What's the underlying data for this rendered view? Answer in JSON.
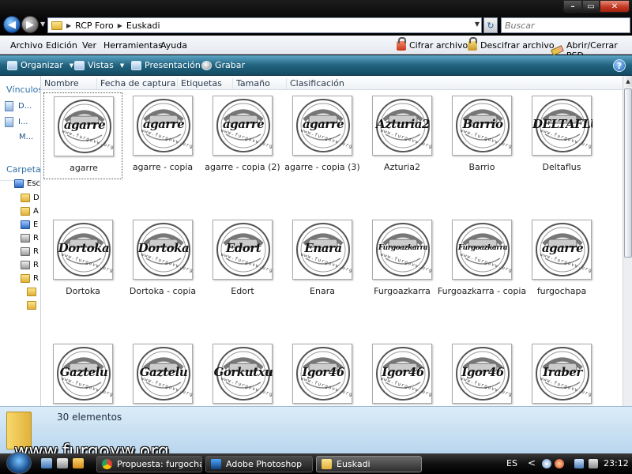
{
  "window": {
    "address_path": [
      "RCP Foro",
      "Euskadi"
    ],
    "search_placeholder": "Buscar"
  },
  "menubar": {
    "items": [
      "Archivo",
      "Edición",
      "Ver",
      "Herramientas",
      "Ayuda"
    ],
    "encrypt": "Cifrar archivo",
    "decrypt": "Descifrar archivo",
    "psd": "Abrir/Cerrar PSD"
  },
  "commandbar": {
    "organize": "Organizar",
    "views": "Vistas",
    "presentation": "Presentación",
    "burn": "Grabar"
  },
  "navpane": {
    "links_title": "Vínculos",
    "links": [
      "D...",
      "I...",
      "M..."
    ],
    "folders_title": "Carpetas",
    "tree": [
      "Esc",
      "D",
      "A",
      "E",
      "R",
      "R",
      "R",
      "R"
    ]
  },
  "columns": [
    "Nombre",
    "Fecha de captura",
    "Etiquetas",
    "Tamaño",
    "Clasificación"
  ],
  "files": [
    {
      "name": "agarre",
      "thumb_text": "agarre",
      "selected": true
    },
    {
      "name": "agarre - copia",
      "thumb_text": "agarre"
    },
    {
      "name": "agarre - copia (2)",
      "thumb_text": "agarre"
    },
    {
      "name": "agarre - copia (3)",
      "thumb_text": "agarre"
    },
    {
      "name": "Azturia2",
      "thumb_text": "Azturia2"
    },
    {
      "name": "Barrio",
      "thumb_text": "Barrio"
    },
    {
      "name": "Deltaflus",
      "thumb_text": "DELTAFLUS"
    },
    {
      "name": "Dortoka",
      "thumb_text": "Dortoka"
    },
    {
      "name": "Dortoka - copia",
      "thumb_text": "Dortoka"
    },
    {
      "name": "Edort",
      "thumb_text": "Edort"
    },
    {
      "name": "Enara",
      "thumb_text": "Enara"
    },
    {
      "name": "Furgoazkarra",
      "thumb_text": "Furgoazkarra"
    },
    {
      "name": "Furgoazkarra - copia",
      "thumb_text": "Furgoazkarra"
    },
    {
      "name": "furgochapa",
      "thumb_text": "agarre"
    },
    {
      "name": "",
      "thumb_text": "Gaztelu"
    },
    {
      "name": "",
      "thumb_text": "Gaztelu"
    },
    {
      "name": "",
      "thumb_text": "Gorkutxu"
    },
    {
      "name": "",
      "thumb_text": "Igor46"
    },
    {
      "name": "",
      "thumb_text": "Igor46"
    },
    {
      "name": "",
      "thumb_text": "Igor46"
    },
    {
      "name": "",
      "thumb_text": "Iraber"
    }
  ],
  "thumb_url_text": "www.furgovw.org",
  "details": {
    "count": "30 elementos",
    "watermark": "www.furgovw.org"
  },
  "taskbar": {
    "buttons": [
      "Propuesta: furgochap...",
      "Adobe Photoshop",
      "Euskadi"
    ],
    "language": "ES",
    "clock": "23:12"
  }
}
